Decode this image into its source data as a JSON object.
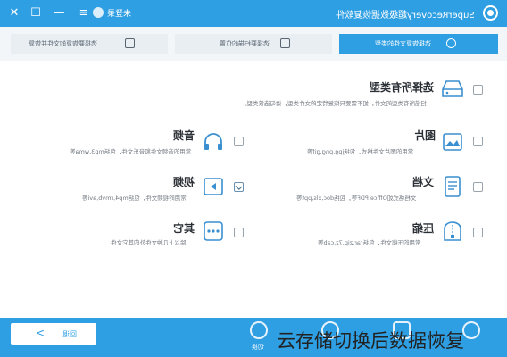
{
  "window": {
    "title": "SuperRecovery超级数据恢复软件",
    "user_label": "未登录",
    "controls": [
      "close-icon",
      "maximize-icon",
      "minimize-icon",
      "menu-icon"
    ]
  },
  "steps": [
    {
      "label": "选择恢复文件的类型",
      "icon": "target-icon",
      "active": true
    },
    {
      "label": "选择要扫描的位置",
      "icon": "drive-icon",
      "active": false
    },
    {
      "label": "选择要恢复的文件并恢复",
      "icon": "document-icon",
      "active": false
    }
  ],
  "select_all": {
    "title": "选择所有类型",
    "desc": "扫描所有类型的文件，如不需要只恢复特定的文件类型，请勾选该类型。",
    "icon": "drive-icon",
    "checked": false
  },
  "types": [
    {
      "key": "pictures",
      "title": "图片",
      "desc": "常用的图片文件格式，包括jpg,png,gif等",
      "icon": "picture-icon",
      "checked": false
    },
    {
      "key": "audio",
      "title": "音频",
      "desc": "常用的音频文件和音乐文件，包括mp3,wma等",
      "icon": "headphones-icon",
      "checked": false
    },
    {
      "key": "documents",
      "title": "文档",
      "desc": "文档格式如Office PDF等，包括doc,xls,ppt等",
      "icon": "document-icon",
      "checked": false
    },
    {
      "key": "video",
      "title": "视频",
      "desc": "常用的视频文件，包括mp4,rmvb,avi等",
      "icon": "video-icon",
      "checked": true
    },
    {
      "key": "archives",
      "title": "压缩",
      "desc": "常用的压缩文件，包括rar,zip,7z,cab等",
      "icon": "archive-icon",
      "checked": false
    },
    {
      "key": "other",
      "title": "其它",
      "desc": "除以上几种文件外的其它文件",
      "icon": "other-icon",
      "checked": false
    }
  ],
  "footer": {
    "back_label": "回退",
    "switch_label": "切换",
    "icons": [
      "switch-icon",
      "database-icon",
      "monitor-icon",
      "globe-icon"
    ]
  },
  "caption": "云存储切换后数据恢复"
}
